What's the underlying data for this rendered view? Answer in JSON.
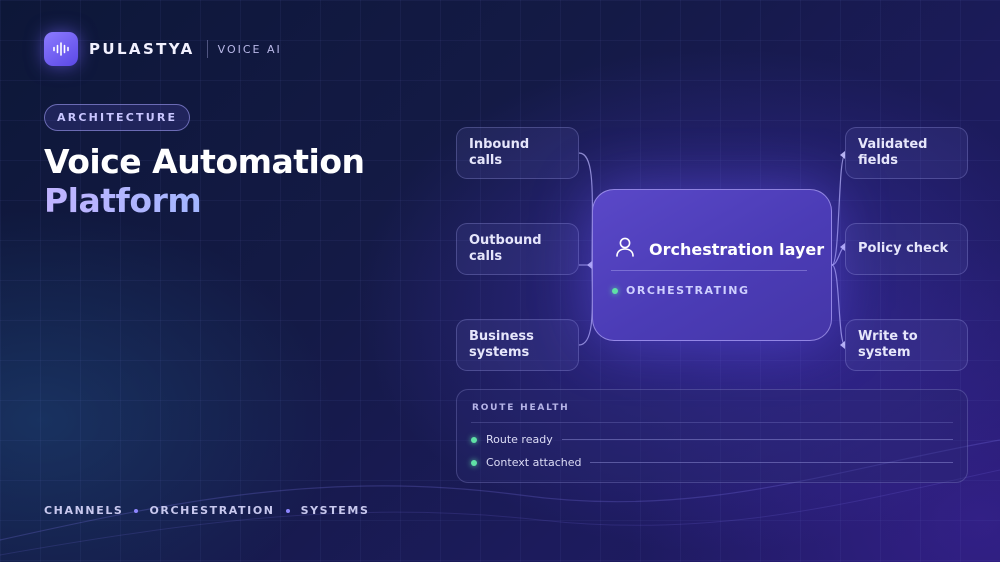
{
  "brand": {
    "name": "PULASTYA",
    "tag": "VOICE AI",
    "icon": "waveform-icon"
  },
  "badge": "ARCHITECTURE",
  "title": {
    "line1": "Voice Automation",
    "line2": "Platform"
  },
  "footer": {
    "items": [
      "CHANNELS",
      "ORCHESTRATION",
      "SYSTEMS"
    ]
  },
  "inputs": [
    {
      "label": "Inbound calls"
    },
    {
      "label": "Outbound calls"
    },
    {
      "label": "Business systems"
    }
  ],
  "hub": {
    "title": "Orchestration layer",
    "status": "ORCHESTRATING",
    "icon": "user-icon"
  },
  "outputs": [
    {
      "label": "Validated fields"
    },
    {
      "label": "Policy check"
    },
    {
      "label": "Write to system"
    }
  ],
  "route_health": {
    "title": "ROUTE HEALTH",
    "items": [
      {
        "label": "Route ready"
      },
      {
        "label": "Context attached"
      }
    ]
  },
  "colors": {
    "accent": "#6a55e6",
    "status_ok": "#5fe0a6",
    "background": "#141a46"
  }
}
